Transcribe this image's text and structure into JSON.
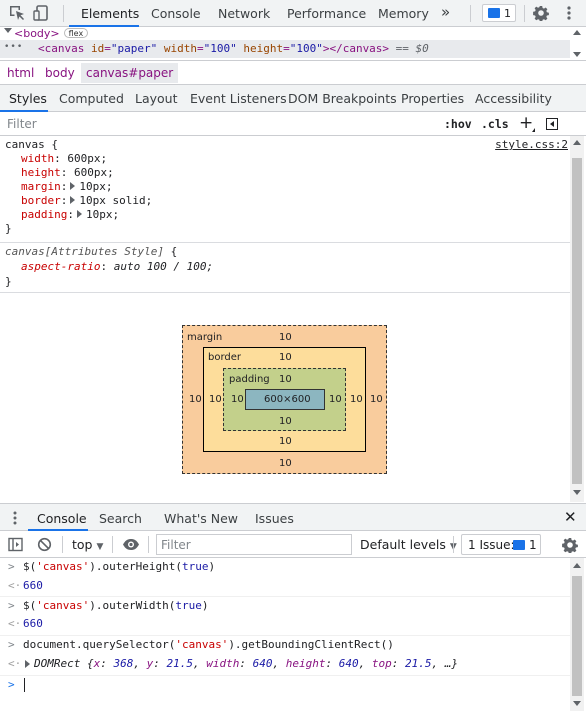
{
  "toolbar": {
    "tabs": [
      "Elements",
      "Console",
      "Network",
      "Performance",
      "Memory"
    ],
    "more": "»",
    "issues_count": "1"
  },
  "domtree": {
    "body_tag": "<body>",
    "flex_badge": "flex",
    "canvas_parts": {
      "open": "<canvas ",
      "id_name": "id",
      "id_value": "\"paper\"",
      "width_name": " width",
      "width_value": "\"100\"",
      "height_name": " height",
      "height_value": "\"100\"",
      "close": "></canvas>",
      "suffix": " == $0"
    },
    "dots": "•••"
  },
  "breadcrumb": [
    "html",
    "body",
    "canvas#paper"
  ],
  "subtabs": [
    "Styles",
    "Computed",
    "Layout",
    "Event Listeners",
    "DOM Breakpoints",
    "Properties",
    "Accessibility"
  ],
  "filter": {
    "placeholder": "Filter",
    "hov": ":hov",
    "cls": ".cls",
    "plus": "+"
  },
  "rules": {
    "canvas": {
      "selector": "canvas {",
      "source": "style.css:2",
      "props": [
        {
          "name": "width",
          "value": "600px;"
        },
        {
          "name": "height",
          "value": "600px;"
        },
        {
          "name": "margin",
          "value": "10px;"
        },
        {
          "name": "border",
          "value": "10px solid;"
        },
        {
          "name": "padding",
          "value": "10px;"
        }
      ],
      "close": "}"
    },
    "attr": {
      "selector": "canvas[Attributes Style]",
      "brace": " {",
      "prop": "aspect-ratio",
      "value": "auto 100 / 100;",
      "close": "}"
    }
  },
  "boxmodel": {
    "margin_label": "margin",
    "border_label": "border",
    "padding_label": "padding",
    "content": "600×600",
    "margin": {
      "top": "10",
      "right": "10",
      "bottom": "10",
      "left": "10"
    },
    "border": {
      "top": "10",
      "right": "10",
      "bottom": "10",
      "left": "10"
    },
    "padding": {
      "top": "10",
      "right": "10",
      "bottom": "10",
      "left": "10"
    }
  },
  "drawer": {
    "tabs": [
      "Console",
      "Search",
      "What's New",
      "Issues"
    ],
    "close": "✕"
  },
  "console_toolbar": {
    "context": "top",
    "filter_placeholder": "Filter",
    "levels": "Default levels",
    "issues_label": "1 Issue:",
    "issues_count": "1"
  },
  "console": {
    "cmd1_pre": "$(",
    "cmd1_str": "'canvas'",
    "cmd1_post": ").outerHeight(",
    "cmd1_arg": "true",
    "cmd1_end": ")",
    "res1": "660",
    "cmd2_pre": "$(",
    "cmd2_str": "'canvas'",
    "cmd2_post": ").outerWidth(",
    "cmd2_arg": "true",
    "cmd2_end": ")",
    "res2": "660",
    "cmd3_pre": "document.querySelector(",
    "cmd3_str": "'canvas'",
    "cmd3_post": ").getBoundingClientRect()",
    "res3_name": "DOMRect ",
    "res3_open": "{",
    "res3_x_k": "x",
    "res3_x_v": "368",
    "res3_y_k": "y",
    "res3_y_v": "21.5",
    "res3_w_k": "width",
    "res3_w_v": "640",
    "res3_h_k": "height",
    "res3_h_v": "640",
    "res3_t_k": "top",
    "res3_t_v": "21.5",
    "res3_tail": ", …}"
  },
  "colors": {
    "accent": "#1a73e8",
    "margin": "#f9cc9d",
    "border": "#fddd9b",
    "padding": "#c3d08b",
    "content": "#8cb6c0"
  }
}
